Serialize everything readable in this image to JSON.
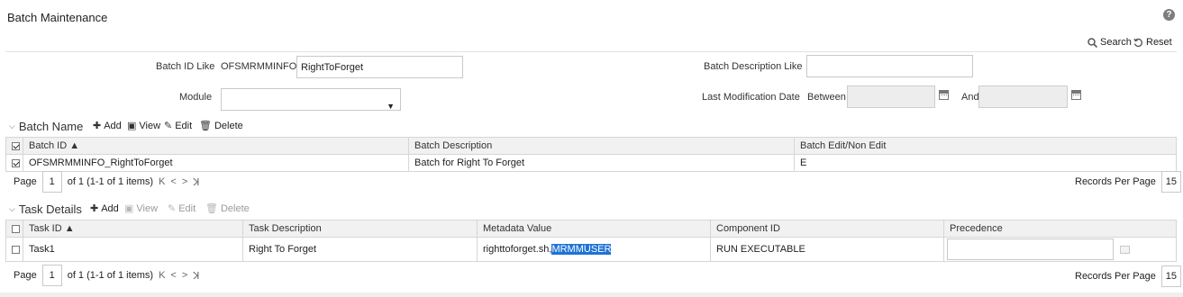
{
  "page": {
    "title": "Batch Maintenance",
    "help": "?"
  },
  "toolbar": {
    "search": "Search",
    "reset": "Reset"
  },
  "filters": {
    "batch_id_label": "Batch ID Like",
    "batch_id_prefix": "OFSMRMMINFO_",
    "batch_id_value": "RightToForget",
    "batch_desc_label": "Batch Description Like",
    "batch_desc_value": "",
    "module_label": "Module",
    "module_value": "",
    "last_mod_label": "Last Modification Date",
    "between_label": "Between",
    "and_label": "And",
    "from_date": "",
    "to_date": ""
  },
  "batch_section": {
    "title": "Batch Name",
    "add": "Add",
    "view": "View",
    "edit": "Edit",
    "delete": "Delete",
    "columns": [
      "Batch ID ▲",
      "Batch Description",
      "Batch Edit/Non Edit"
    ],
    "rows": [
      {
        "checked": true,
        "id": "OFSMRMMINFO_RightToForget",
        "description": "Batch for Right To Forget",
        "edit": "E"
      }
    ],
    "pager": {
      "page_label": "Page",
      "page": "1",
      "info": "of 1 (1-1 of 1 items)",
      "records_label": "Records Per Page",
      "records": "15"
    }
  },
  "task_section": {
    "title": "Task Details",
    "add": "Add",
    "view": "View",
    "edit": "Edit",
    "delete": "Delete",
    "columns": [
      "Task ID ▲",
      "Task Description",
      "Metadata Value",
      "Component ID",
      "Precedence"
    ],
    "rows": [
      {
        "checked": false,
        "id": "Task1",
        "description": "Right To Forget",
        "metadata_plain": "righttoforget.sh,",
        "metadata_selected": "MRMMUSER",
        "component": "RUN EXECUTABLE",
        "precedence": ""
      }
    ],
    "pager": {
      "page_label": "Page",
      "page": "1",
      "info": "of 1 (1-1 of 1 items)",
      "records_label": "Records Per Page",
      "records": "15"
    }
  },
  "icons": {
    "search": "search-icon",
    "reset": "reset-icon",
    "help": "help-icon",
    "add": "plus-icon",
    "view": "view-icon",
    "edit": "edit-icon",
    "delete": "trash-icon",
    "calendar": "calendar-icon",
    "first": "first-page-icon",
    "prev": "prev-page-icon",
    "next": "next-page-icon",
    "last": "last-page-icon"
  },
  "colors": {
    "selection": "#1e73d6",
    "header_bg": "#f1f1f1",
    "disabled_input": "#ededed"
  }
}
